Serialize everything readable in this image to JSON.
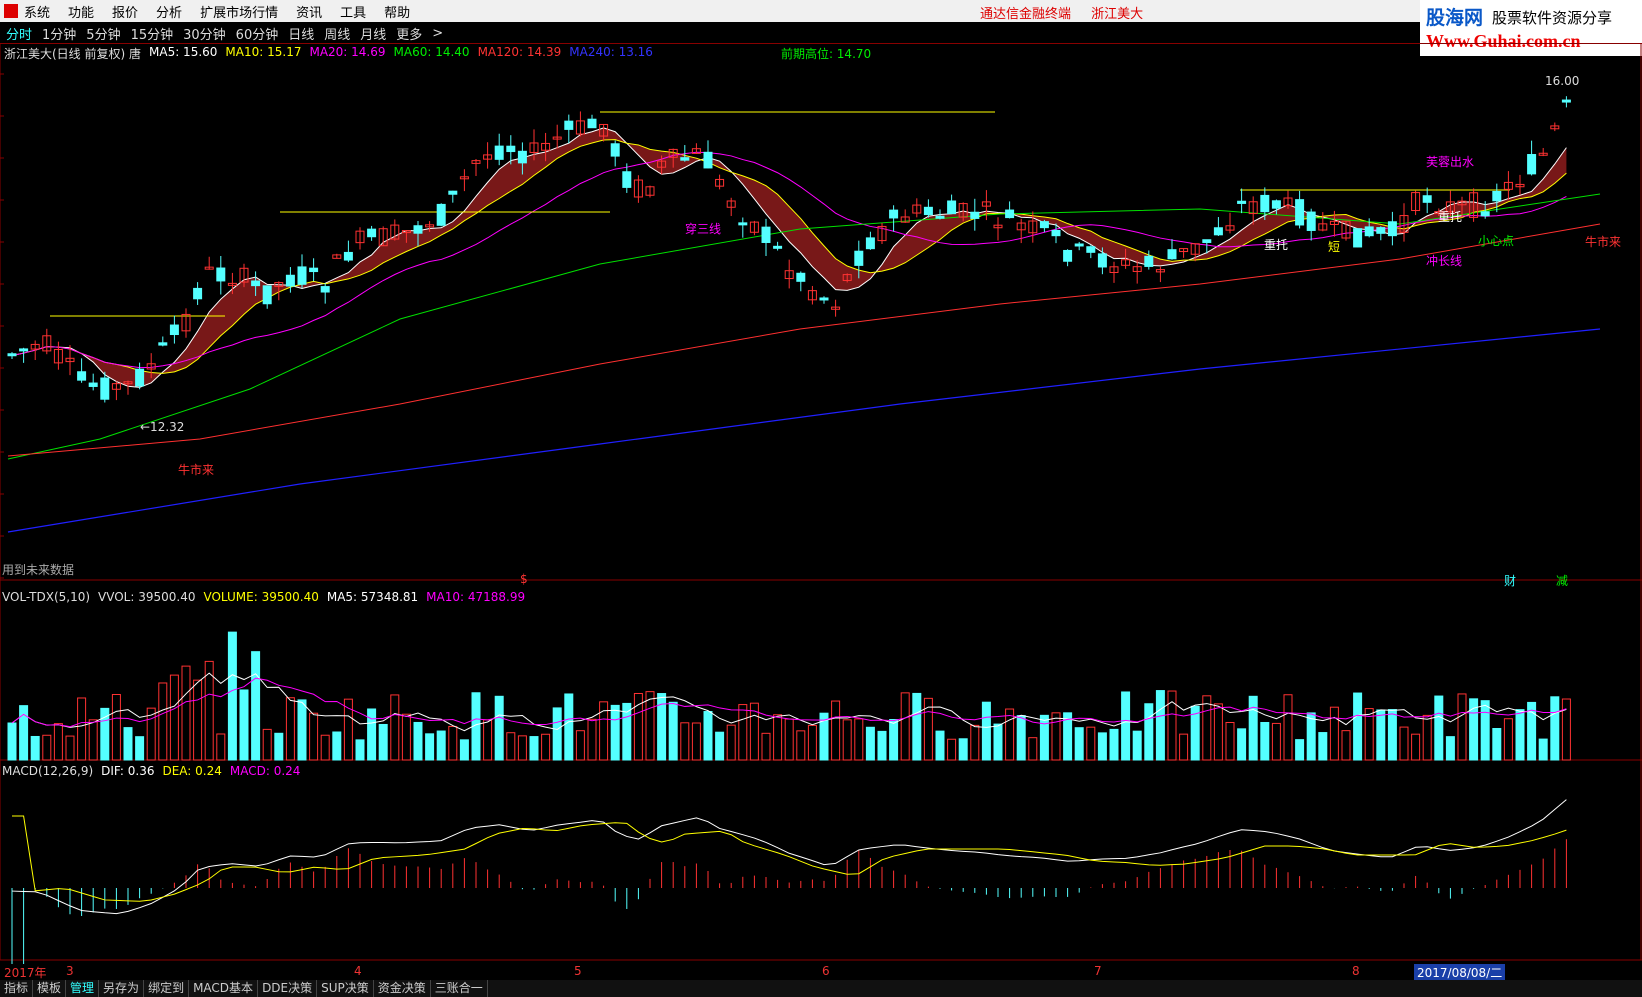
{
  "menubar": {
    "items": [
      "系统",
      "功能",
      "报价",
      "分析",
      "扩展市场行情",
      "资讯",
      "工具",
      "帮助"
    ],
    "center_texts": [
      "通达信金融终端",
      "浙江美大"
    ]
  },
  "brand": {
    "name": "股海网",
    "slogan": "股票软件资源分享",
    "url": "Www.Guhai.com.cn"
  },
  "period_tabs": [
    "分时",
    "1分钟",
    "5分钟",
    "15分钟",
    "30分钟",
    "60分钟",
    "日线",
    "周线",
    "月线",
    "更多",
    ">"
  ],
  "main_legend": {
    "title": "浙江美大(日线 前复权) 唐",
    "ma5": "MA5: 15.60",
    "ma10": "MA10: 15.17",
    "ma20": "MA20: 14.69",
    "ma60": "MA60: 14.40",
    "ma120": "MA120: 14.39",
    "ma240": "MA240: 13.16",
    "prev_high": "前期高位: 14.70"
  },
  "annotations": {
    "low_label": "←12.32",
    "high_label": "16.00",
    "bull_left": "牛市来",
    "bull_right": "牛市来",
    "cross_three": "穿三线",
    "lotus": "芙蓉出水",
    "support1": "重托",
    "support2": "重托",
    "short_note": "短",
    "careful": "小心点",
    "long_line": "冲长线",
    "future_data": "用到未来数据",
    "fin": "财",
    "reduce": "减",
    "dollar": "$"
  },
  "vol_legend": {
    "name": "VOL-TDX(5,10)",
    "vvol": "VVOL: 39500.40",
    "volume": "VOLUME: 39500.40",
    "ma5": "MA5: 57348.81",
    "ma10": "MA10: 47188.99"
  },
  "macd_legend": {
    "name": "MACD(12,26,9)",
    "dif": "DIF: 0.36",
    "dea": "DEA: 0.24",
    "macd": "MACD: 0.24"
  },
  "time_axis": [
    "2017年",
    "3",
    "4",
    "5",
    "6",
    "7",
    "8",
    "2017/08/08/二"
  ],
  "bottom_tabs": [
    "指标",
    "模板",
    "管理",
    "另存为",
    "绑定到",
    "MACD基本",
    "DDE决策",
    "SUP决策",
    "资金决策",
    "三账合一"
  ],
  "colors": {
    "up": "#ff3232",
    "down": "#54ffff",
    "ma5": "#ffffff",
    "ma10": "#ffff00",
    "ma20": "#ff00ff",
    "ma60": "#00e000",
    "ma120": "#ff3030",
    "ma240": "#2020ff",
    "ribbon_up": "#a02020",
    "ribbon_down": "#5a8a30"
  }
}
